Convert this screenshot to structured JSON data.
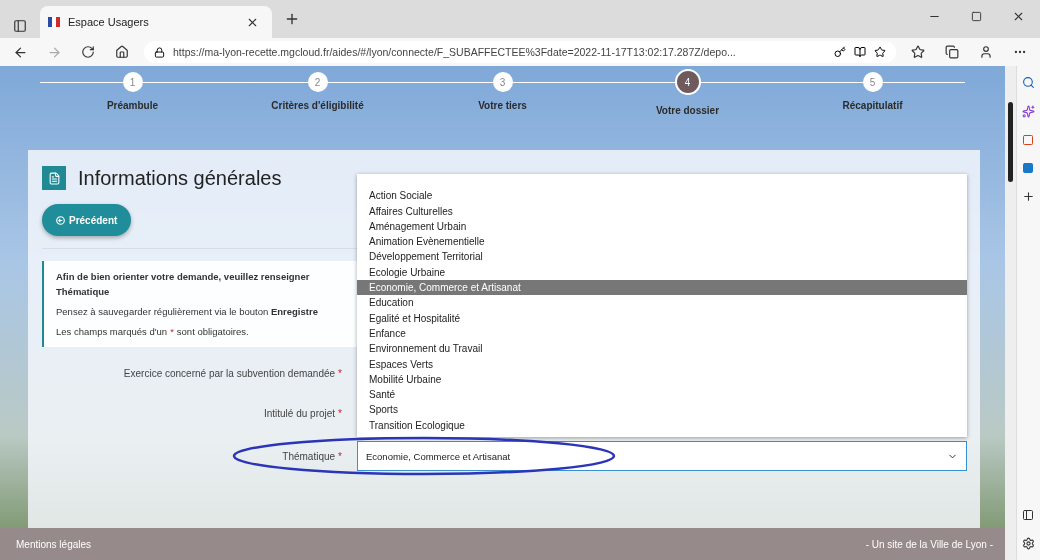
{
  "browser": {
    "tab": {
      "title": "Espace Usagers"
    },
    "url": "https://ma-lyon-recette.mgcloud.fr/aides/#/lyon/connecte/F_SUBAFFECTEE%3Fdate=2022-11-17T13:02:17.287Z/depo..."
  },
  "steps": [
    {
      "number": "1",
      "label": "Préambule",
      "selected": false
    },
    {
      "number": "2",
      "label": "Critères d'éligibilité",
      "selected": false
    },
    {
      "number": "3",
      "label": "Votre tiers",
      "selected": false
    },
    {
      "number": "4",
      "label": "Votre dossier",
      "selected": true
    },
    {
      "number": "5",
      "label": "Récapitulatif",
      "selected": false
    }
  ],
  "section": {
    "title": "Informations générales",
    "previous_button": "Précédent"
  },
  "info": {
    "intro": "Afin de bien orienter votre demande, veuillez renseigner",
    "intro_bold": "Thématique",
    "save_hint": "Pensez à sauvegarder régulièrement via le bouton **Enregistre**",
    "required_before": "Les champs marqués d'un",
    "required_mark": "*",
    "required_after": "sont obligatoires."
  },
  "fields": [
    {
      "label": "Exercice concerné par la subvention demandée",
      "mark": "*"
    },
    {
      "label": "Intitulé du projet",
      "mark": "*"
    },
    {
      "label": "Thématique",
      "mark": "*",
      "value": "Economie, Commerce et Artisanat",
      "expanded": true,
      "options": [
        {
          "label": "Action Sociale",
          "selected": false
        },
        {
          "label": "Affaires Culturelles",
          "selected": false
        },
        {
          "label": "Aménagement Urbain",
          "selected": false
        },
        {
          "label": "Animation Evènementielle",
          "selected": false
        },
        {
          "label": "Développement Territorial",
          "selected": false
        },
        {
          "label": "Ecologie Urbaine",
          "selected": false
        },
        {
          "label": "Economie, Commerce et Artisanat",
          "selected": true
        },
        {
          "label": "Education",
          "selected": false
        },
        {
          "label": "Egalité et Hospitalité",
          "selected": false
        },
        {
          "label": "Enfance",
          "selected": false
        },
        {
          "label": "Environnement du Travail",
          "selected": false
        },
        {
          "label": "Espaces Verts",
          "selected": false
        },
        {
          "label": "Mobilité Urbaine",
          "selected": false
        },
        {
          "label": "Santé",
          "selected": false
        },
        {
          "label": "Sports",
          "selected": false
        },
        {
          "label": "Transition Ecologique",
          "selected": false
        }
      ]
    }
  ],
  "footer": {
    "left": "Mentions légales",
    "right": "- Un site de la Ville de Lyon -"
  }
}
